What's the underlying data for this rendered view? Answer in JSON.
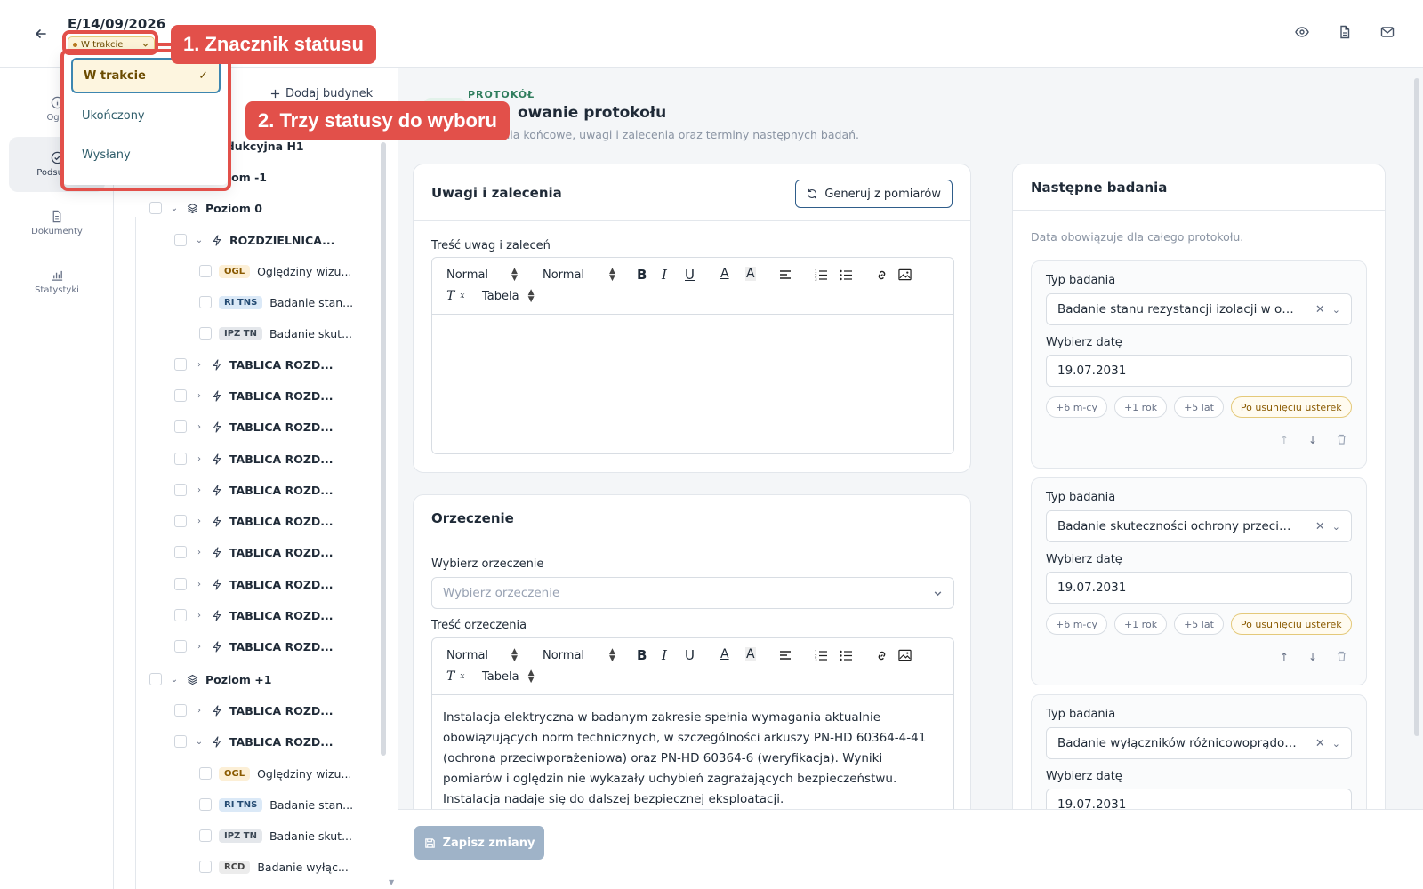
{
  "header": {
    "doc_title": "E/14/09/2026",
    "status_label": "W trakcie",
    "icons": [
      "eye-icon",
      "file-icon",
      "mail-icon"
    ]
  },
  "rail": {
    "items": [
      {
        "label": "Ogól"
      },
      {
        "label": "Podsumo"
      },
      {
        "label": "Dokumenty"
      },
      {
        "label": "Statystyki"
      }
    ]
  },
  "tree": {
    "add_building": "Dodaj budynek",
    "building": "rodukcyjna H1",
    "levels": {
      "minus1": "oziom -1",
      "zero": "Poziom 0",
      "plus1": "Poziom +1"
    },
    "rozdzielnica": "ROZDZIELNICA...",
    "tablica": "TABLICA ROZD...",
    "tag_ogl": "OGL",
    "tag_ritns": "RI TNS",
    "tag_ipztn": "IPZ TN",
    "tag_rcd": "RCD",
    "item_ogl": "Oględziny wizu...",
    "item_ritns": "Badanie stan...",
    "item_ipztn": "Badanie skut...",
    "item_rcd": "Badanie wyłąc..."
  },
  "protocol": {
    "label": "PROTOKÓŁ",
    "title": "owanie protokołu",
    "subtitle": "Ustalenia końcowe, uwagi i zalecenia oraz terminy następnych badań."
  },
  "remarks": {
    "title": "Uwagi i zalecenia",
    "generate_button": "Generuj z pomiarów",
    "content_label": "Treść uwag i zaleceń"
  },
  "editor_toolbar": {
    "format1": "Normal",
    "format2": "Normal",
    "table": "Tabela"
  },
  "verdict": {
    "title": "Orzeczenie",
    "select_label": "Wybierz orzeczenie",
    "select_placeholder": "Wybierz orzeczenie",
    "content_label": "Treść orzeczenia",
    "content": "Instalacja elektryczna w badanym zakresie spełnia wymagania aktualnie obowiązujących norm technicznych, w szczególności arkuszy PN-HD 60364-4-41 (ochrona przeciwporażeniowa) oraz PN-HD 60364-6 (weryfikacja). Wyniki pomiarów i oględzin nie wykazały uchybień zagrażających bezpieczeństwu. Instalacja nadaje się do dalszej bezpiecznej eksploatacji."
  },
  "next": {
    "title": "Następne badania",
    "note": "Data obowiązuje dla całego protokołu.",
    "type_label": "Typ badania",
    "date_label": "Wybierz datę",
    "chips": [
      "+6 m-cy",
      "+1 rok",
      "+5 lat",
      "Po usunięciu usterek"
    ],
    "exams": [
      {
        "type": "Badanie stanu rezystancji izolacji w obwodach",
        "date": "19.07.2031"
      },
      {
        "type": "Badanie skuteczności ochrony przeciwporażeniowej",
        "date": "19.07.2031"
      },
      {
        "type": "Badanie wyłączników różnicowoprądowych",
        "date": "19.07.2031"
      }
    ]
  },
  "footer": {
    "save": "Zapisz zmiany"
  },
  "status_dropdown": {
    "options": [
      "W trakcie",
      "Ukończony",
      "Wysłany"
    ],
    "selected": "W trakcie"
  },
  "callouts": {
    "one": "1. Znacznik statusu",
    "two": "2. Trzy statusy do wyboru"
  },
  "colors": {
    "callout": "#e2504a",
    "status_bg": "#fcf3d8",
    "primary": "#2f5d8a",
    "save_disabled": "#9fb3c8"
  }
}
